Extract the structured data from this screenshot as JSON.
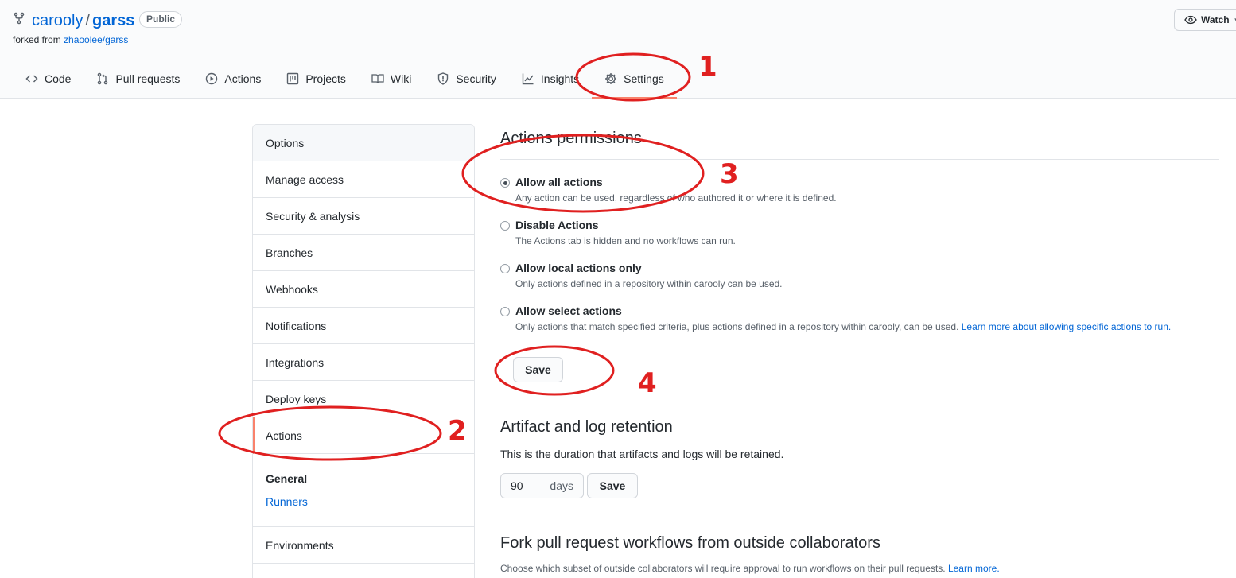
{
  "repo": {
    "owner": "carooly",
    "separator": "/",
    "name": "garss",
    "visibility": "Public",
    "forked_prefix": "forked from ",
    "forked_source": "zhaoolee/garss",
    "watch_label": "Watch"
  },
  "tabs": [
    {
      "label": "Code",
      "icon": "code-icon"
    },
    {
      "label": "Pull requests",
      "icon": "pull-request-icon"
    },
    {
      "label": "Actions",
      "icon": "play-icon"
    },
    {
      "label": "Projects",
      "icon": "project-icon"
    },
    {
      "label": "Wiki",
      "icon": "book-icon"
    },
    {
      "label": "Security",
      "icon": "shield-icon"
    },
    {
      "label": "Insights",
      "icon": "graph-icon"
    },
    {
      "label": "Settings",
      "icon": "gear-icon",
      "selected": true
    }
  ],
  "sidebar": {
    "items": [
      "Options",
      "Manage access",
      "Security & analysis",
      "Branches",
      "Webhooks",
      "Notifications",
      "Integrations",
      "Deploy keys",
      "Actions",
      "Environments"
    ],
    "selected": "Actions",
    "sub_heading": "General",
    "sub_link": "Runners"
  },
  "permissions": {
    "title": "Actions permissions",
    "options": [
      {
        "label": "Allow all actions",
        "note": "Any action can be used, regardless of who authored it or where it is defined.",
        "checked": true
      },
      {
        "label": "Disable Actions",
        "note": "The Actions tab is hidden and no workflows can run.",
        "checked": false
      },
      {
        "label": "Allow local actions only",
        "note": "Only actions defined in a repository within carooly can be used.",
        "checked": false
      },
      {
        "label": "Allow select actions",
        "note": "Only actions that match specified criteria, plus actions defined in a repository within carooly, can be used. ",
        "link": "Learn more about allowing specific actions to run.",
        "checked": false
      }
    ],
    "save_label": "Save"
  },
  "retention": {
    "title": "Artifact and log retention",
    "description": "This is the duration that artifacts and logs will be retained.",
    "days_value": "90",
    "days_unit": "days",
    "save_label": "Save"
  },
  "fork_section": {
    "title": "Fork pull request workflows from outside collaborators",
    "note": "Choose which subset of outside collaborators will require approval to run workflows on their pull requests. ",
    "link": "Learn more."
  },
  "annotations": {
    "color": "#e02020",
    "steps": [
      "1",
      "2",
      "3",
      "4"
    ]
  },
  "colors": {
    "link": "#0366d6",
    "selected_accent": "#f9826c"
  }
}
